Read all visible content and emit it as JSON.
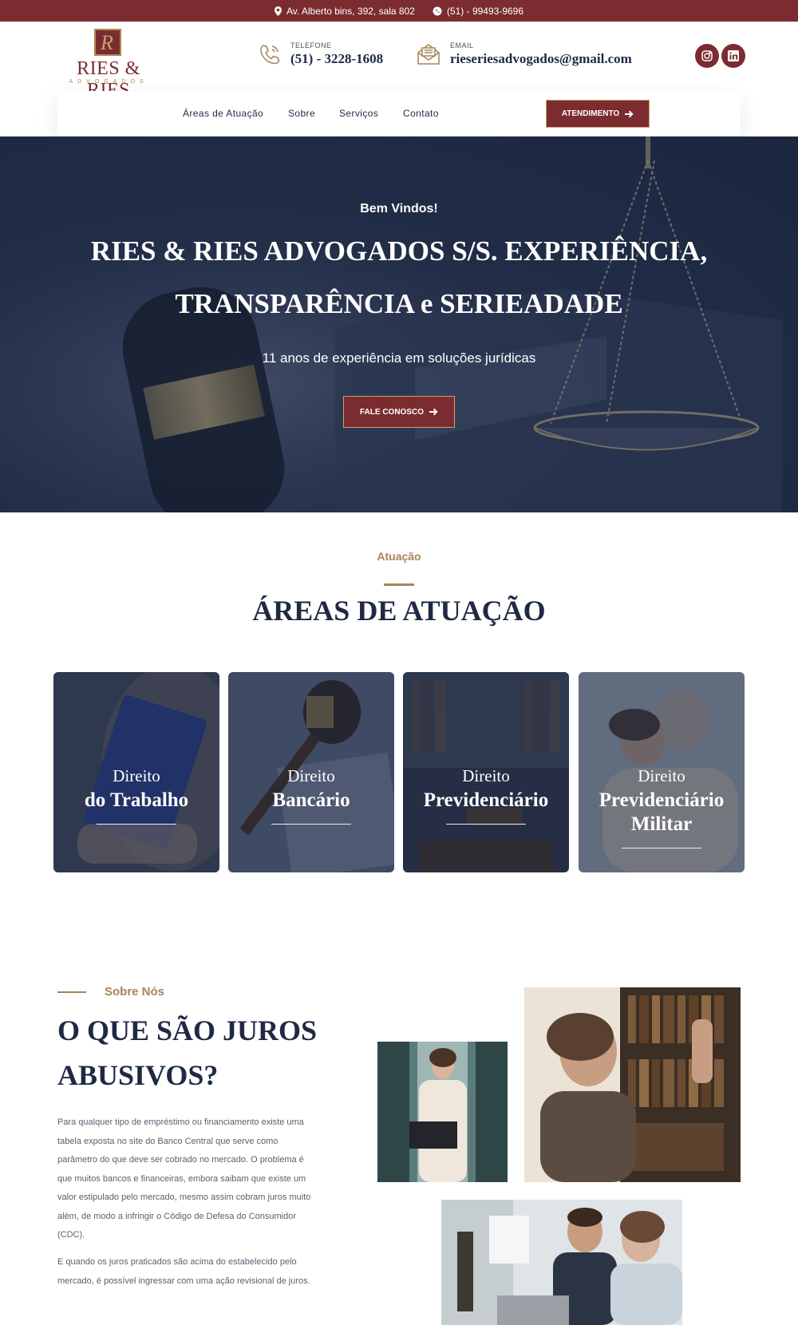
{
  "topbar": {
    "address": "Av. Alberto bins, 392, sala 802",
    "whatsapp": "(51) - 99493-9696",
    "bg_color": "#7b2c31"
  },
  "header": {
    "logo": {
      "name": "RIES & RIES",
      "tagline": "ADVOGADOS"
    },
    "phone": {
      "label": "TELEFONE",
      "value": "(51) - 3228-1608",
      "icon": "phone-icon"
    },
    "email": {
      "label": "EMAIL",
      "value": "rieseriesadvogados@gmail.com",
      "icon": "envelope-icon"
    },
    "social": [
      "instagram-icon",
      "linkedin-icon"
    ]
  },
  "nav": {
    "items": [
      "Áreas de Atuação",
      "Sobre",
      "Serviços",
      "Contato"
    ],
    "cta": "ATENDIMENTO"
  },
  "hero": {
    "welcome": "Bem Vindos!",
    "title": "RIES & RIES ADVOGADOS S/S. EXPERIÊNCIA, TRANSPARÊNCIA e SERIEADADE",
    "subtitle": "11 anos de experiência em soluções jurídicas",
    "cta": "FALE CONOSCO"
  },
  "areas": {
    "eyebrow": "Atuação",
    "title": "ÁREAS DE ATUAÇÃO",
    "cards": [
      {
        "line1": "Direito",
        "line2": "do Trabalho"
      },
      {
        "line1": "Direito",
        "line2": "Bancário"
      },
      {
        "line1": "Direito",
        "line2": "Previdenciário"
      },
      {
        "line1": "Direito",
        "line2": "Previdenciário Militar"
      }
    ]
  },
  "about": {
    "eyebrow": "Sobre Nós",
    "title_line1": "O QUE SÃO JUROS",
    "title_line2": "ABUSIVOS?",
    "paragraph1": "Para qualquer tipo de empréstimo ou financiamento existe uma tabela exposta no site do Banco Central que serve como parâmetro do que deve ser cobrado no mercado. O problema é que muitos bancos e financeiras, embora saibam que existe um valor estipulado pelo mercado, mesmo assim cobram juros muito além, de modo a infringir o Código de Defesa do Consumidor (CDC).",
    "paragraph2": "E quando os juros praticados são acima do estabelecido pelo mercado, é possível ingressar com uma ação revisional de juros."
  },
  "colors": {
    "brand": "#7b2c31",
    "gold": "#a6845a",
    "navy": "#1e2a44"
  }
}
